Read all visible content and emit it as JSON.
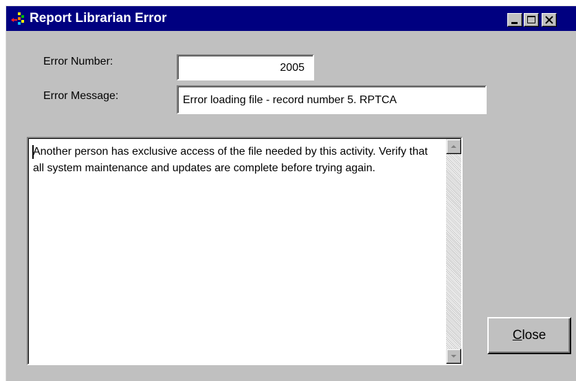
{
  "window": {
    "title": "Report Librarian Error",
    "title_bar_color": "#000080",
    "face_color": "#c0c0c0",
    "icon": "app-logo-icon",
    "controls": [
      "minimize-icon",
      "maximize-icon",
      "close-icon"
    ]
  },
  "form": {
    "error_number_label": "Error Number:",
    "error_number_value": "2005",
    "error_message_label": "Error Message:",
    "error_message_value": "Error loading file - record number 5.  RPTCA"
  },
  "details": {
    "text": "Another person has exclusive access of the file needed by this activity.  Verify that all system maintenance and updates are complete before trying again."
  },
  "buttons": {
    "close_mnemonic": "C",
    "close_rest": "lose"
  }
}
